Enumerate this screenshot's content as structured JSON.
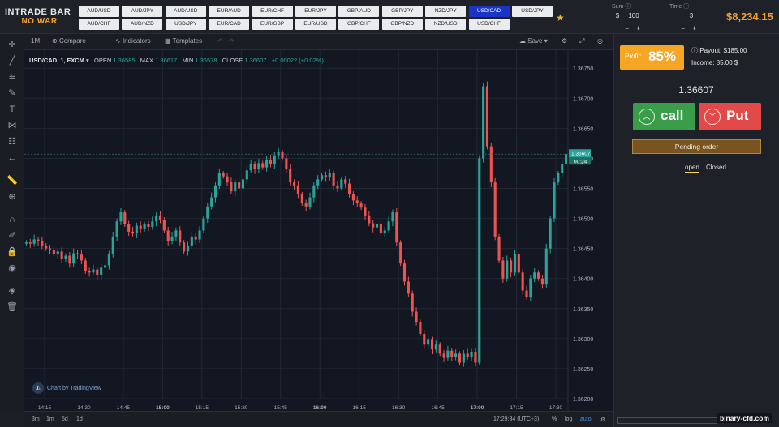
{
  "logo": {
    "line1": "INTRADE BAR",
    "line2": "NO WAR"
  },
  "pairs": [
    [
      "AUD/USD",
      "AUD/JPY",
      "AUD/USD",
      "EUR/AUD",
      "EUR/CHF",
      "EUR/JPY",
      "GBP/AUD",
      "GBP/JPY",
      "NZD/JPY",
      "USD/CAD",
      "USD/JPY"
    ],
    [
      "AUD/CHF",
      "AUD/NZD",
      "USD/JPY",
      "EUR/CAD",
      "EUR/GBP",
      "EUR/USD",
      "GBP/CHF",
      "GBP/NZD",
      "NZD/USD",
      "USD/CHF"
    ]
  ],
  "active_pair": "USD/CAD",
  "trade": {
    "sum_label": "Sum",
    "sum_currency": "$",
    "sum_value": "100",
    "time_label": "Time",
    "time_value": "3",
    "minus": "−",
    "plus": "+",
    "balance": "$8,234.15"
  },
  "toolbar": {
    "interval": "1M",
    "compare": "Compare",
    "indicators": "Indicators",
    "templates": "Templates",
    "save": "Save"
  },
  "legend": {
    "symbol": "USD/CAD, 1, FXCM",
    "open_label": "OPEN",
    "open": "1.36585",
    "max_label": "MAX",
    "max": "1.36617",
    "min_label": "MIN",
    "min": "1.36578",
    "close_label": "CLOSE",
    "close": "1.36607",
    "change": "+0.00022 (+0.02%)"
  },
  "tv_credit": "Chart by TradingView",
  "bottombar": {
    "ranges": [
      "3m",
      "1m",
      "5d",
      "1d"
    ],
    "clock": "17:29:34 (UTC+3)",
    "percent": "%",
    "log": "log",
    "auto": "auto"
  },
  "panel": {
    "profit_label": "Profit:",
    "profit_value": "85%",
    "payout": "Payout: $185.00",
    "income": "Income: 85.00 $",
    "current_price": "1.36607",
    "call_label": "call",
    "put_label": "Put",
    "pending": "Pending order",
    "tab_open": "open",
    "tab_closed": "Closed"
  },
  "watermark": "binary-cfd.com",
  "colors": {
    "up": "#26a69a",
    "down": "#ef5350",
    "accent": "#f5a623",
    "call": "#3a9d4a",
    "put": "#e24a4a"
  },
  "chart_data": {
    "type": "candlestick",
    "symbol": "USD/CAD",
    "interval": "1",
    "source": "FXCM",
    "x_ticks": [
      "14:15",
      "14:30",
      "14:45",
      "15:00",
      "15:15",
      "15:30",
      "15:45",
      "16:00",
      "16:15",
      "16:30",
      "16:45",
      "17:00",
      "17:15",
      "17:30"
    ],
    "y_ticks": [
      "1.36750",
      "1.36700",
      "1.36650",
      "1.36600",
      "1.36550",
      "1.36500",
      "1.36450",
      "1.36400",
      "1.36350",
      "1.36300",
      "1.36250",
      "1.36200"
    ],
    "ylim": [
      1.362,
      1.3678
    ],
    "last_price_label": "1.36607",
    "countdown": "00:24",
    "closes": [
      1.3646,
      1.36458,
      1.36465,
      1.36462,
      1.36455,
      1.3645,
      1.36448,
      1.3644,
      1.36445,
      1.36432,
      1.36438,
      1.36425,
      1.36442,
      1.3644,
      1.3643,
      1.36412,
      1.3641,
      1.36415,
      1.36405,
      1.36418,
      1.36422,
      1.3644,
      1.3647,
      1.36495,
      1.3651,
      1.3649,
      1.36478,
      1.36475,
      1.36488,
      1.36482,
      1.3649,
      1.36486,
      1.36495,
      1.36505,
      1.36498,
      1.3648,
      1.36462,
      1.3647,
      1.3648,
      1.3646,
      1.36445,
      1.36455,
      1.3647,
      1.36465,
      1.3648,
      1.365,
      1.3652,
      1.36535,
      1.36555,
      1.36575,
      1.3657,
      1.3656,
      1.36545,
      1.3656,
      1.3655,
      1.36565,
      1.3658,
      1.3659,
      1.36582,
      1.36592,
      1.36585,
      1.36598,
      1.3659,
      1.36605,
      1.3661,
      1.366,
      1.36582,
      1.3656,
      1.36555,
      1.3654,
      1.36525,
      1.3652,
      1.36535,
      1.36555,
      1.36565,
      1.36572,
      1.36568,
      1.36575,
      1.36555,
      1.3655,
      1.36565,
      1.36558,
      1.3654,
      1.3653,
      1.36525,
      1.36518,
      1.36505,
      1.36492,
      1.36485,
      1.3649,
      1.36475,
      1.3648,
      1.36495,
      1.3651,
      1.3646,
      1.36425,
      1.36395,
      1.36375,
      1.36345,
      1.36328,
      1.36308,
      1.3629,
      1.36298,
      1.36282,
      1.3629,
      1.36275,
      1.36268,
      1.3628,
      1.3627,
      1.36275,
      1.3626,
      1.36275,
      1.3627,
      1.36278,
      1.3626,
      1.366,
      1.3672,
      1.3662,
      1.3656,
      1.3647,
      1.3643,
      1.364,
      1.3643,
      1.3641,
      1.3644,
      1.3641,
      1.3638,
      1.3637,
      1.364,
      1.3641,
      1.364,
      1.3639,
      1.3645,
      1.365,
      1.3656,
      1.36575,
      1.3659,
      1.36607
    ]
  }
}
